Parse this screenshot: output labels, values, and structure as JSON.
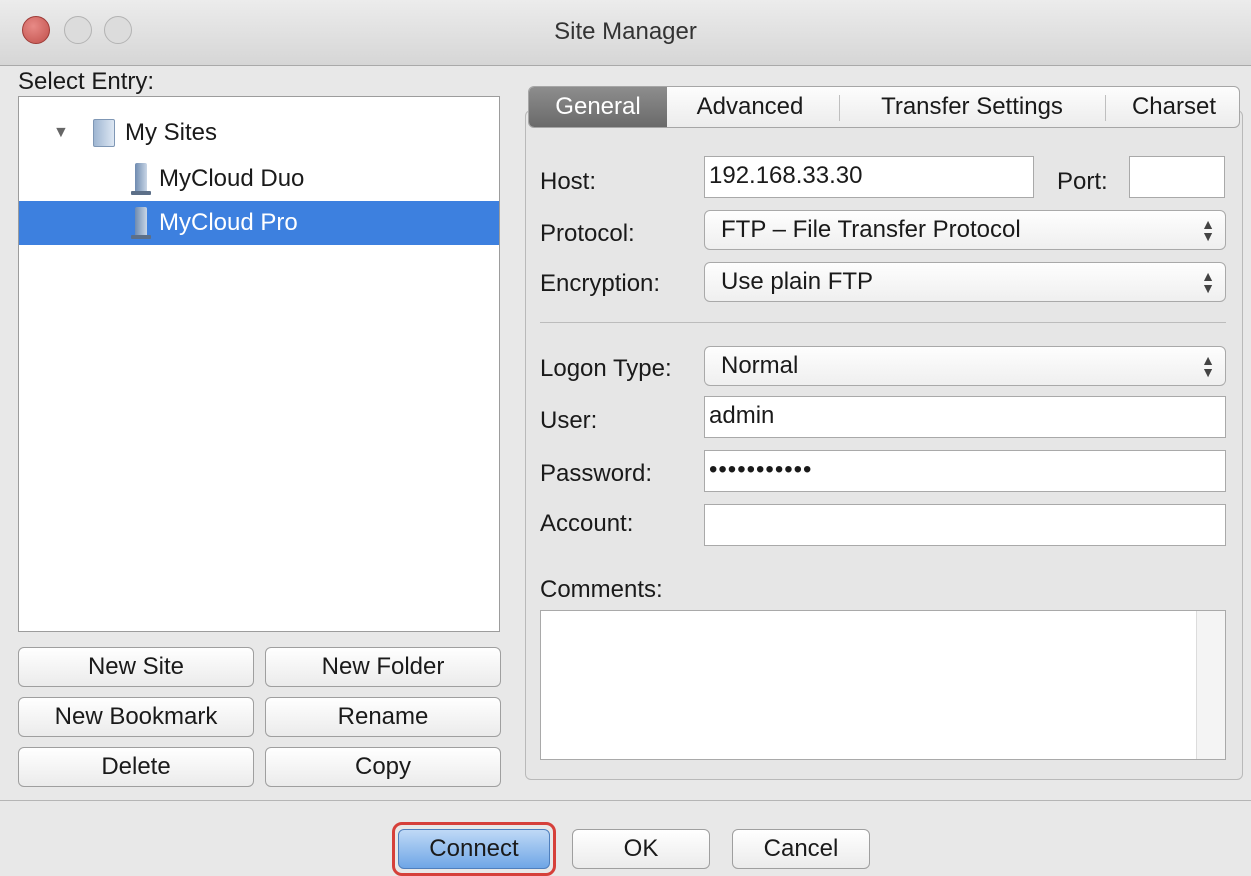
{
  "window": {
    "title": "Site Manager"
  },
  "left": {
    "select_entry_label": "Select Entry:",
    "tree": [
      {
        "label": "My Sites"
      },
      {
        "label": "MyCloud Duo"
      },
      {
        "label": "MyCloud Pro",
        "selected": true
      }
    ],
    "buttons": {
      "new_site": "New Site",
      "new_folder": "New Folder",
      "new_bookmark": "New Bookmark",
      "rename": "Rename",
      "delete": "Delete",
      "copy": "Copy"
    }
  },
  "tabs": [
    "General",
    "Advanced",
    "Transfer Settings",
    "Charset"
  ],
  "active_tab": "General",
  "general": {
    "host_label": "Host:",
    "host_value": "192.168.33.30",
    "port_label": "Port:",
    "port_value": "",
    "protocol_label": "Protocol:",
    "protocol_value": "FTP – File Transfer Protocol",
    "encryption_label": "Encryption:",
    "encryption_value": "Use plain FTP",
    "logon_type_label": "Logon Type:",
    "logon_type_value": "Normal",
    "user_label": "User:",
    "user_value": "admin",
    "password_label": "Password:",
    "password_value": "•••••••••••",
    "account_label": "Account:",
    "account_value": "",
    "comments_label": "Comments:",
    "comments_value": ""
  },
  "footer": {
    "connect": "Connect",
    "ok": "OK",
    "cancel": "Cancel"
  },
  "colors": {
    "selection": "#3d80df",
    "focus_ring": "#d6403a"
  }
}
